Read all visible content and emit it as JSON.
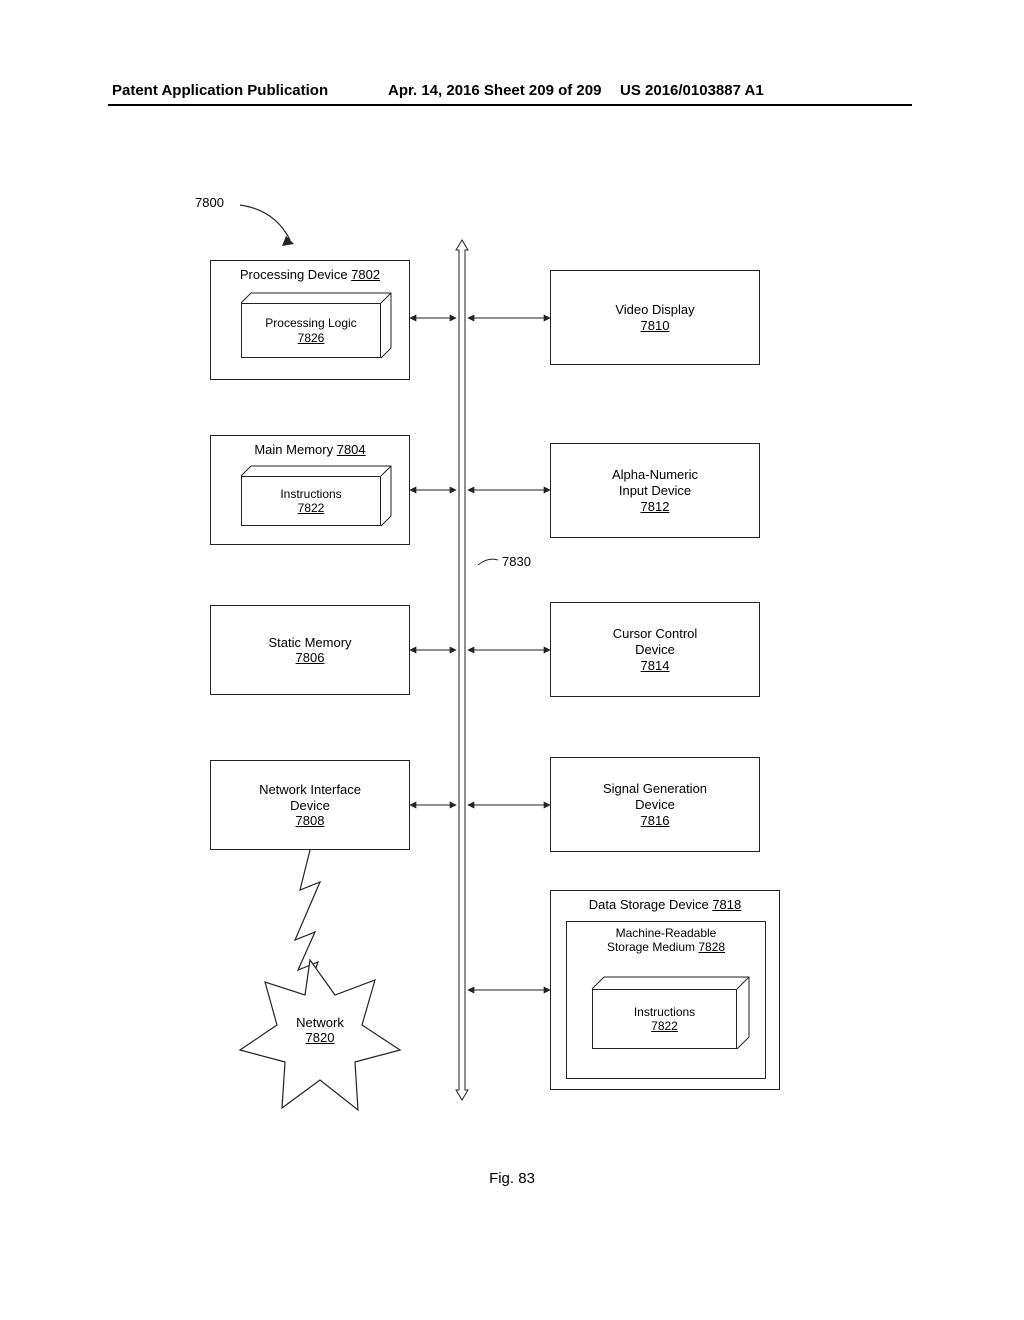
{
  "header": {
    "left": "Patent Application Publication",
    "mid": "Apr. 14, 2016  Sheet 209 of 209",
    "right": "US 2016/0103887 A1"
  },
  "figure_label": "Fig. 83",
  "system_ref": "7800",
  "bus_ref": "7830",
  "blocks": {
    "processing_device": {
      "title": "Processing Device",
      "num": "7802"
    },
    "processing_logic": {
      "title": "Processing Logic",
      "num": "7826"
    },
    "main_memory": {
      "title": "Main Memory",
      "num": "7804"
    },
    "instructions": {
      "title": "Instructions",
      "num": "7822"
    },
    "static_memory": {
      "title": "Static Memory",
      "num": "7806"
    },
    "nic": {
      "title": "Network Interface",
      "title2": "Device",
      "num": "7808"
    },
    "video_display": {
      "title": "Video Display",
      "num": "7810"
    },
    "alpha_numeric": {
      "title": "Alpha-Numeric",
      "title2": "Input Device",
      "num": "7812"
    },
    "cursor_control": {
      "title": "Cursor Control",
      "title2": "Device",
      "num": "7814"
    },
    "signal_gen": {
      "title": "Signal Generation",
      "title2": "Device",
      "num": "7816"
    },
    "data_storage": {
      "title": "Data Storage Device",
      "num": "7818"
    },
    "mrsm": {
      "title": "Machine-Readable",
      "title2": "Storage Medium",
      "num": "7828"
    },
    "instructions2": {
      "title": "Instructions",
      "num": "7822"
    },
    "network": {
      "title": "Network",
      "num": "7820"
    }
  }
}
